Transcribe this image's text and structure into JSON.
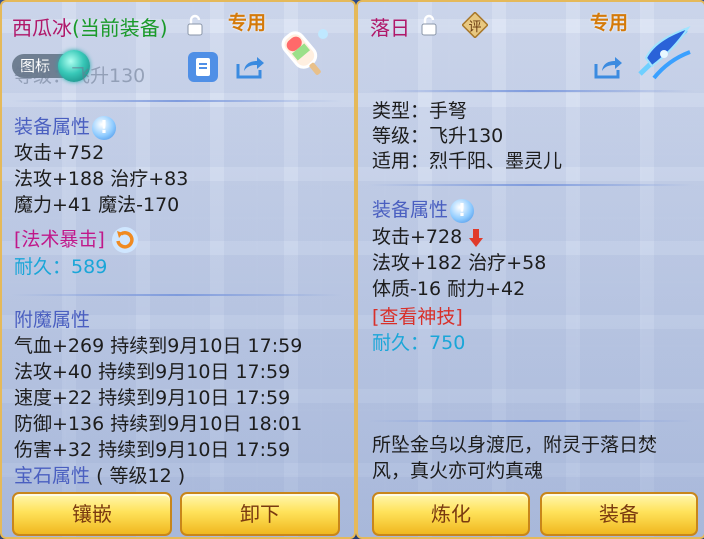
{
  "left": {
    "title_name": "西瓜冰",
    "title_status": "(当前装备)",
    "exclusive": "专用",
    "tag_label": "图标",
    "partial_level_text": "等级：飞升130",
    "base_section": "装备属性",
    "base_lines": [
      "攻击+752",
      "法攻+188 治疗+83",
      "魔力+41 魔法-170"
    ],
    "special": "[法术暴击]",
    "durability_label": "耐久：",
    "durability_value": "589",
    "enchant_section": "附魔属性",
    "enchant_lines": [
      "气血+269 持续到9月10日 17:59",
      "法攻+40 持续到9月10日 17:59",
      "速度+22 持续到9月10日 17:59",
      "防御+136 持续到9月10日 18:01",
      "伤害+32 持续到9月10日 17:59"
    ],
    "gem_section": "宝石属性",
    "gem_level": "( 等级12 )",
    "buttons": [
      "镶嵌",
      "卸下"
    ]
  },
  "right": {
    "title_name": "落日",
    "rate_label": "评",
    "exclusive": "专用",
    "type_line": "类型：手弩",
    "level_line": "等级：飞升130",
    "suit_line": "适用：烈千阳、墨灵儿",
    "base_section": "装备属性",
    "base_lines": [
      "攻击+728",
      "法攻+182 治疗+58",
      "体质-16 耐力+42"
    ],
    "skill_link": "[查看神技]",
    "durability_label": "耐久：",
    "durability_value": "750",
    "description": "所坠金乌以身渡厄，附灵于落日焚风，真火亦可灼真魂",
    "buttons": [
      "炼化",
      "装备"
    ]
  },
  "colors": {
    "title": "#b0186a",
    "equipped": "#1a9a2a",
    "section": "#4a5fc0",
    "durability": "#1aa6d8",
    "special": "#c0188a",
    "link": "#d8302a",
    "button": "#ffe25a"
  },
  "icons": [
    "lock-icon",
    "hint-icon",
    "share-icon",
    "stat-down-arrow-icon",
    "item-portrait-icon"
  ]
}
